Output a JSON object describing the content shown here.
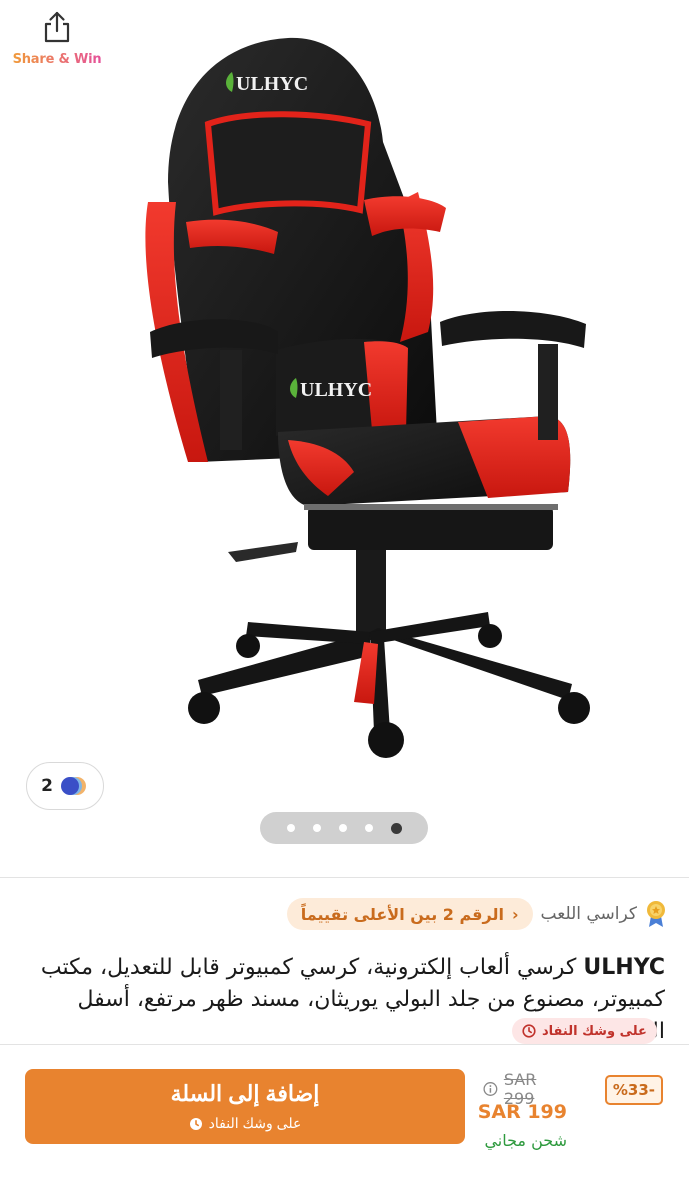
{
  "share": {
    "label": "Share & Win",
    "icon": "share-icon"
  },
  "gallery": {
    "brand_logo_text": "ULHYC",
    "variant_count": "2",
    "slides_total": 5,
    "active_slide": 5
  },
  "category": {
    "name": "كراسي اللعب",
    "icon": "medal-icon"
  },
  "rank_badge": {
    "label": "الرقم 2 بين الأعلى تقييماً"
  },
  "product": {
    "brand": "ULHYC",
    "title": "كرسي ألعاب إلكترونية، كرسي كمبيوتر قابل للتعديل، مكتب كمبيوتر، مصنوع من جلد البولي يوريثان، مسند ظهر مرتفع، أسفل الظهر",
    "stock_badge": "على وشك النفاد"
  },
  "purchase": {
    "add_to_cart": "إضافة إلى السلة",
    "cart_subtext": "على وشك النفاد",
    "discount": "%33-",
    "old_price": "SAR 299",
    "new_price": "SAR 199",
    "shipping": "شحن مجاني"
  },
  "colors": {
    "accent": "#e8832f",
    "chair_red": "#e2231a",
    "free_ship": "#2e9a3e",
    "stock_red": "#c0322b"
  }
}
